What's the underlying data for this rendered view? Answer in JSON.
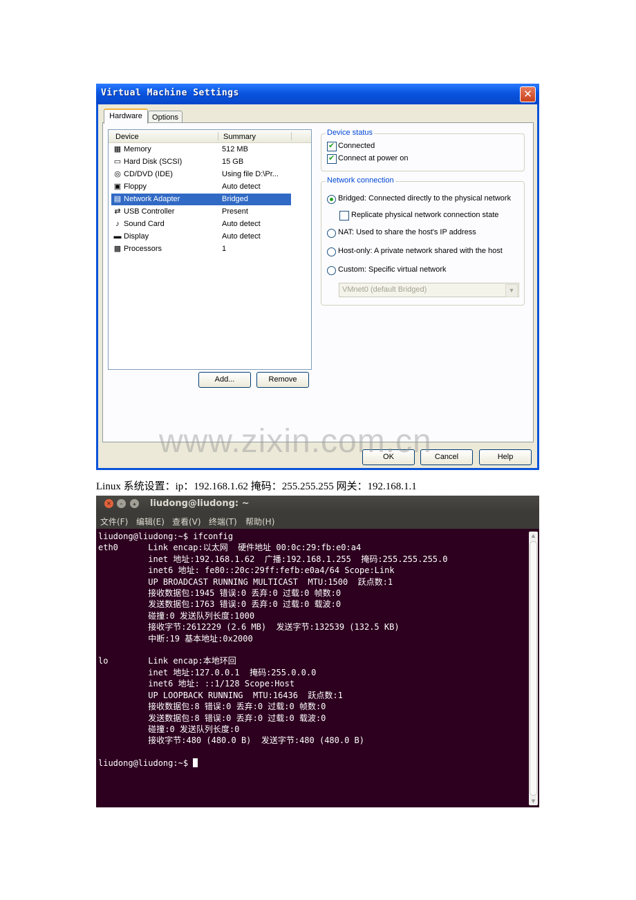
{
  "vm_window": {
    "title": "Virtual Machine Settings",
    "close_glyph": "✕",
    "tabs": [
      "Hardware",
      "Options"
    ],
    "list_headers": {
      "device": "Device",
      "summary": "Summary"
    },
    "devices": [
      {
        "name": "Memory",
        "summary": "512 MB",
        "icon": "memory-icon",
        "glyph": "▦"
      },
      {
        "name": "Hard Disk (SCSI)",
        "summary": "15 GB",
        "icon": "hard-disk-icon",
        "glyph": "▭"
      },
      {
        "name": "CD/DVD (IDE)",
        "summary": "Using file D:\\Pr...",
        "icon": "cd-dvd-icon",
        "glyph": "◎"
      },
      {
        "name": "Floppy",
        "summary": "Auto detect",
        "icon": "floppy-icon",
        "glyph": "▣"
      },
      {
        "name": "Network Adapter",
        "summary": "Bridged",
        "icon": "network-adapter-icon",
        "glyph": "▤"
      },
      {
        "name": "USB Controller",
        "summary": "Present",
        "icon": "usb-icon",
        "glyph": "⇄"
      },
      {
        "name": "Sound Card",
        "summary": "Auto detect",
        "icon": "sound-card-icon",
        "glyph": "♪"
      },
      {
        "name": "Display",
        "summary": "Auto detect",
        "icon": "display-icon",
        "glyph": "▬"
      },
      {
        "name": "Processors",
        "summary": "1",
        "icon": "processor-icon",
        "glyph": "▩"
      }
    ],
    "selected_device": "Network Adapter",
    "add_button": "Add...",
    "remove_button": "Remove",
    "device_status": {
      "legend": "Device status",
      "connected": {
        "label": "Connected",
        "checked": true
      },
      "connect_at_power_on": {
        "label": "Connect at power on",
        "checked": true
      }
    },
    "network_connection": {
      "legend": "Network connection",
      "bridged": {
        "label": "Bridged: Connected directly to the physical network",
        "selected": true
      },
      "replicate": {
        "label": "Replicate physical network connection state",
        "checked": false
      },
      "nat": {
        "label": "NAT: Used to share the host's IP address",
        "selected": false
      },
      "host_only": {
        "label": "Host-only: A private network shared with the host",
        "selected": false
      },
      "custom": {
        "label": "Custom: Specific virtual network",
        "selected": false
      },
      "vmnet_select": "VMnet0 (default Bridged)"
    },
    "ok_button": "OK",
    "cancel_button": "Cancel",
    "help_button": "Help",
    "watermark": "www.zixin.com.cn"
  },
  "caption": "Linux  系统设置：ip：192.168.1.62  掩码：255.255.255  网关：192.168.1.1",
  "terminal": {
    "title": "liudong@liudong: ~",
    "menu": [
      "文件(F)",
      "编辑(E)",
      "查看(V)",
      "终端(T)",
      "帮助(H)"
    ],
    "lines": [
      "liudong@liudong:~$ ifconfig",
      "eth0      Link encap:以太网  硬件地址 00:0c:29:fb:e0:a4",
      "          inet 地址:192.168.1.62  广播:192.168.1.255  掩码:255.255.255.0",
      "          inet6 地址: fe80::20c:29ff:fefb:e0a4/64 Scope:Link",
      "          UP BROADCAST RUNNING MULTICAST  MTU:1500  跃点数:1",
      "          接收数据包:1945 错误:0 丢弃:0 过载:0 帧数:0",
      "          发送数据包:1763 错误:0 丢弃:0 过载:0 载波:0",
      "          碰撞:0 发送队列长度:1000",
      "          接收字节:2612229 (2.6 MB)  发送字节:132539 (132.5 KB)",
      "          中断:19 基本地址:0x2000",
      "",
      "lo        Link encap:本地环回",
      "          inet 地址:127.0.0.1  掩码:255.0.0.0",
      "          inet6 地址: ::1/128 Scope:Host",
      "          UP LOOPBACK RUNNING  MTU:16436  跃点数:1",
      "          接收数据包:8 错误:0 丢弃:0 过载:0 帧数:0",
      "          发送数据包:8 错误:0 丢弃:0 过载:0 载波:0",
      "          碰撞:0 发送队列长度:0",
      "          接收字节:480 (480.0 B)  发送字节:480 (480.0 B)",
      ""
    ],
    "prompt": "liudong@liudong:~$ "
  }
}
